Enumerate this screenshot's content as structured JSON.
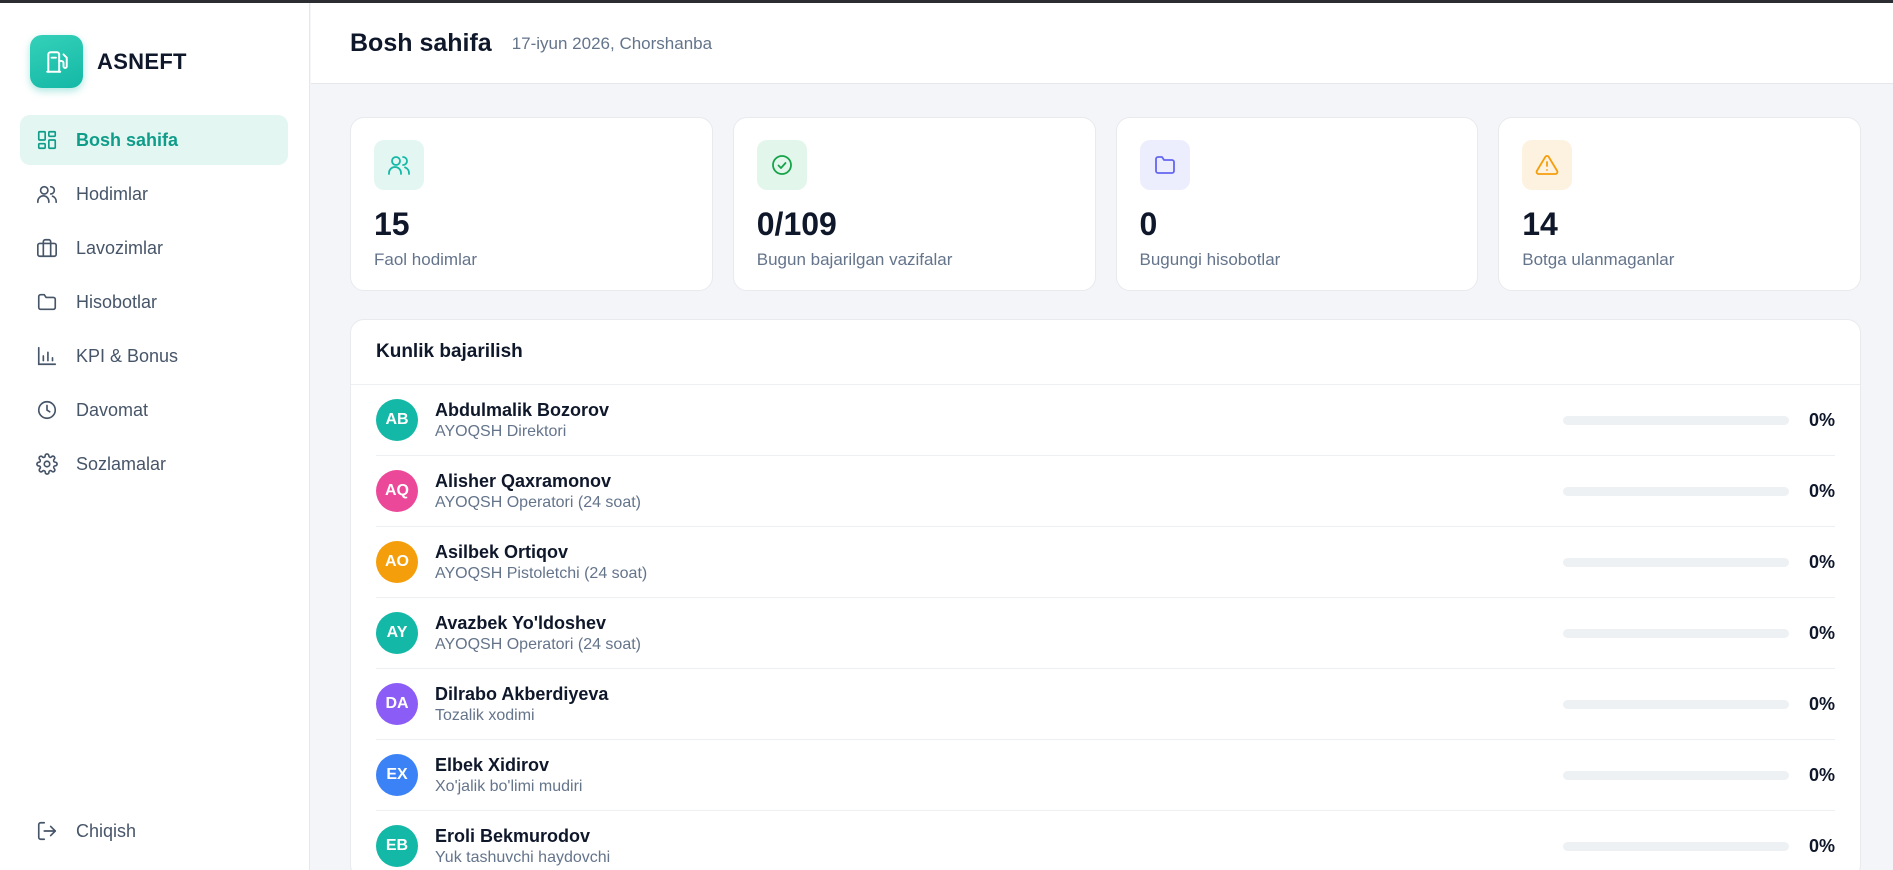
{
  "brand": {
    "name": "ASNEFT"
  },
  "nav": {
    "items": [
      {
        "label": "Bosh sahifa",
        "icon": "dashboard-icon",
        "active": true
      },
      {
        "label": "Hodimlar",
        "icon": "users-icon"
      },
      {
        "label": "Lavozimlar",
        "icon": "briefcase-icon"
      },
      {
        "label": "Hisobotlar",
        "icon": "folder-icon"
      },
      {
        "label": "KPI & Bonus",
        "icon": "bar-chart-icon"
      },
      {
        "label": "Davomat",
        "icon": "clock-icon"
      },
      {
        "label": "Sozlamalar",
        "icon": "gear-icon"
      }
    ],
    "logout_label": "Chiqish"
  },
  "header": {
    "title": "Bosh sahifa",
    "date": "17-iyun 2026, Chorshanba"
  },
  "stats": [
    {
      "value": "15",
      "label": "Faol hodimlar",
      "icon": "users-icon",
      "color": "#14b8a6",
      "bg": "#e3f6f2"
    },
    {
      "value": "0/109",
      "label": "Bugun bajarilgan vazifalar",
      "icon": "check-circle-icon",
      "color": "#16a34a",
      "bg": "#e3f6ec"
    },
    {
      "value": "0",
      "label": "Bugungi hisobotlar",
      "icon": "folder-icon",
      "color": "#6366f1",
      "bg": "#eceefd"
    },
    {
      "value": "14",
      "label": "Botga ulanmaganlar",
      "icon": "warning-icon",
      "color": "#f59e0b",
      "bg": "#fdf1e0"
    }
  ],
  "daily": {
    "title": "Kunlik bajarilish",
    "rows": [
      {
        "initials": "AB",
        "name": "Abdulmalik Bozorov",
        "role": "AYOQSH Direktori",
        "progress": 0,
        "percent": "0%",
        "color": "#14b8a6"
      },
      {
        "initials": "AQ",
        "name": "Alisher Qaxramonov",
        "role": "AYOQSH Operatori (24 soat)",
        "progress": 0,
        "percent": "0%",
        "color": "#ec4899"
      },
      {
        "initials": "AO",
        "name": "Asilbek Ortiqov",
        "role": "AYOQSH Pistoletchi (24 soat)",
        "progress": 0,
        "percent": "0%",
        "color": "#f59e0b"
      },
      {
        "initials": "AY",
        "name": "Avazbek Yo'ldoshev",
        "role": "AYOQSH Operatori (24 soat)",
        "progress": 0,
        "percent": "0%",
        "color": "#14b8a6"
      },
      {
        "initials": "DA",
        "name": "Dilrabo Akberdiyeva",
        "role": "Tozalik xodimi",
        "progress": 0,
        "percent": "0%",
        "color": "#8b5cf6"
      },
      {
        "initials": "EX",
        "name": "Elbek Xidirov",
        "role": "Xo'jalik bo'limi mudiri",
        "progress": 0,
        "percent": "0%",
        "color": "#3b82f6"
      },
      {
        "initials": "EB",
        "name": "Eroli Bekmurodov",
        "role": "Yuk tashuvchi haydovchi",
        "progress": 0,
        "percent": "0%",
        "color": "#14b8a6"
      }
    ]
  }
}
